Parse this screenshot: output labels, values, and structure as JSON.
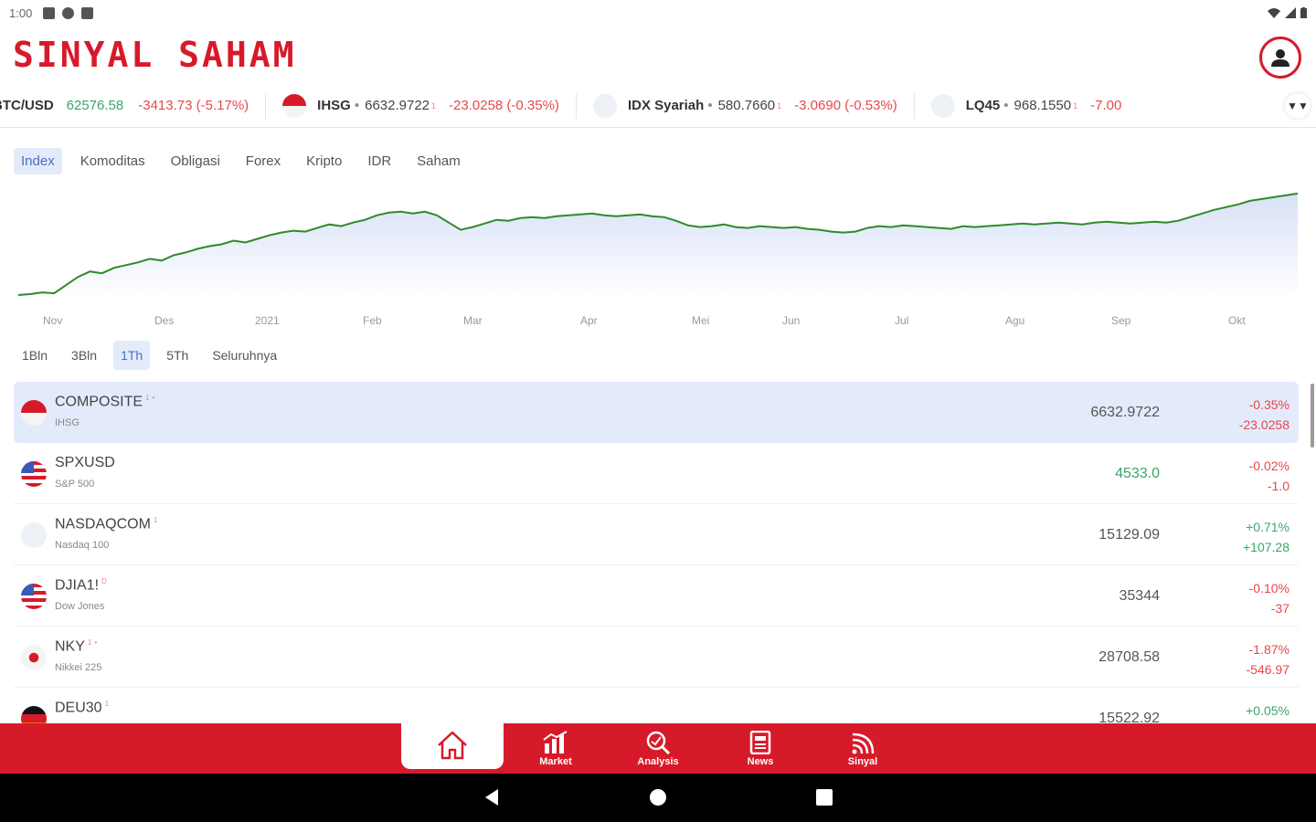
{
  "status_bar": {
    "time": "1:00"
  },
  "header": {
    "brand": "SINYAL SAHAM",
    "profile_icon": "user-icon"
  },
  "ticker": [
    {
      "symbol": "BTC/USD",
      "price": "62576.58",
      "price_color": "green",
      "change": "-3413.73 (-5.17%)",
      "flag": "none"
    },
    {
      "symbol": "IHSG",
      "dot": "•",
      "price": "6632.9722",
      "sup": "1",
      "change": "-23.0258 (-0.35%)",
      "flag": "id"
    },
    {
      "symbol": "IDX Syariah",
      "dot": "•",
      "price": "580.7660",
      "sup": "1",
      "change": "-3.0690 (-0.53%)",
      "flag": "blank"
    },
    {
      "symbol": "LQ45",
      "dot": "•",
      "price": "968.1550",
      "sup": "1",
      "change": "-7.00",
      "flag": "blank"
    }
  ],
  "ticker_menu_label": "▼▼",
  "market_tabs": [
    {
      "label": "Index",
      "active": true
    },
    {
      "label": "Komoditas",
      "active": false
    },
    {
      "label": "Obligasi",
      "active": false
    },
    {
      "label": "Forex",
      "active": false
    },
    {
      "label": "Kripto",
      "active": false
    },
    {
      "label": "IDR",
      "active": false
    },
    {
      "label": "Saham",
      "active": false
    }
  ],
  "chart_data": {
    "type": "area",
    "x_tick_labels": [
      "Nov",
      "Des",
      "2021",
      "Feb",
      "Mar",
      "Apr",
      "Mei",
      "Jun",
      "Jul",
      "Agu",
      "Sep",
      "Okt"
    ],
    "values": [
      5000,
      5010,
      5030,
      5020,
      5110,
      5200,
      5260,
      5240,
      5300,
      5330,
      5360,
      5400,
      5380,
      5440,
      5470,
      5510,
      5540,
      5560,
      5600,
      5580,
      5620,
      5660,
      5690,
      5710,
      5700,
      5740,
      5780,
      5760,
      5800,
      5830,
      5880,
      5910,
      5920,
      5900,
      5920,
      5880,
      5800,
      5720,
      5750,
      5790,
      5830,
      5820,
      5850,
      5860,
      5850,
      5870,
      5880,
      5890,
      5900,
      5880,
      5870,
      5880,
      5890,
      5870,
      5860,
      5820,
      5770,
      5750,
      5760,
      5780,
      5750,
      5740,
      5760,
      5750,
      5740,
      5750,
      5730,
      5720,
      5700,
      5690,
      5700,
      5740,
      5760,
      5750,
      5770,
      5760,
      5750,
      5740,
      5730,
      5760,
      5750,
      5760,
      5770,
      5780,
      5790,
      5780,
      5790,
      5800,
      5790,
      5780,
      5800,
      5810,
      5800,
      5790,
      5800,
      5810,
      5800,
      5820,
      5860,
      5900,
      5940,
      5970,
      6000,
      6040,
      6060,
      6080,
      6100,
      6120
    ],
    "ylim": [
      4950,
      6200
    ],
    "line_color": "#2f8a2a",
    "fill_color": "#dce6f7"
  },
  "timeframes": [
    {
      "label": "1Bln",
      "active": false
    },
    {
      "label": "3Bln",
      "active": false
    },
    {
      "label": "1Th",
      "active": true
    },
    {
      "label": "5Th",
      "active": false
    },
    {
      "label": "Seluruhnya",
      "active": false
    }
  ],
  "index_rows": [
    {
      "symbol": "COMPOSITE",
      "sup": "1",
      "star": "•",
      "name": "IHSG",
      "price": "6632.9722",
      "price_green": false,
      "pct": "-0.35%",
      "chg": "-23.0258",
      "dir": "neg",
      "flag": "id",
      "active": true
    },
    {
      "symbol": "SPXUSD",
      "sup": "",
      "star": "",
      "name": "S&P 500",
      "price": "4533.0",
      "price_green": true,
      "pct": "-0.02%",
      "chg": "-1.0",
      "dir": "neg",
      "flag": "us",
      "active": false
    },
    {
      "symbol": "NASDAQCOM",
      "sup": "1",
      "star": "",
      "name": "Nasdaq 100",
      "price": "15129.09",
      "price_green": false,
      "pct": "+0.71%",
      "chg": "+107.28",
      "dir": "pos",
      "flag": "blank",
      "active": false
    },
    {
      "symbol": "DJIA1!",
      "sup": "D",
      "star": "",
      "name": "Dow Jones",
      "price": "35344",
      "price_green": false,
      "pct": "-0.10%",
      "chg": "-37",
      "dir": "neg",
      "flag": "us",
      "active": false
    },
    {
      "symbol": "NKY",
      "sup": "1",
      "star": "•",
      "name": "Nikkei 225",
      "price": "28708.58",
      "price_green": false,
      "pct": "-1.87%",
      "chg": "-546.97",
      "dir": "neg",
      "flag": "jp",
      "active": false
    },
    {
      "symbol": "DEU30",
      "sup": "1",
      "star": "",
      "name": "",
      "price": "15522.92",
      "price_green": false,
      "pct": "+0.05%",
      "chg": "",
      "dir": "pos",
      "flag": "de",
      "active": false
    }
  ],
  "bottom_nav": [
    {
      "label": "",
      "icon": "home-icon"
    },
    {
      "label": "Market",
      "icon": "market-chart-icon"
    },
    {
      "label": "Analysis",
      "icon": "analysis-magnifier-icon"
    },
    {
      "label": "News",
      "icon": "news-icon"
    },
    {
      "label": "Sinyal",
      "icon": "signal-icon"
    }
  ],
  "colors": {
    "brand": "#d71a2a",
    "negative": "#e8474c",
    "positive": "#3aa66a",
    "active_tab": "#e3ebfb"
  }
}
